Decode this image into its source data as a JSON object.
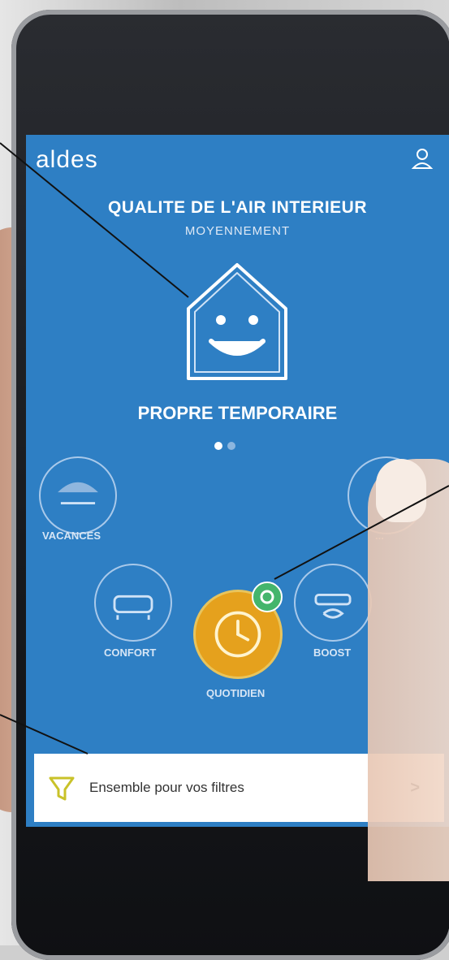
{
  "app": {
    "logo": "aldes",
    "user_icon": "user-icon"
  },
  "air_quality": {
    "title": "QUALITE DE L'AIR INTERIEUR",
    "subtitle": "MOYENNEMENT",
    "status": "PROPRE TEMPORAIRE",
    "page_index": 1,
    "page_count": 2
  },
  "modes": {
    "left_top_label": "VACANCES",
    "left_label": "CONFORT",
    "center_label": "QUOTIDIEN",
    "right_label": "BOOST",
    "right_top_label": "...",
    "active_color": "#e5a11d",
    "badge_color": "#44b56c"
  },
  "promo": {
    "text": "Ensemble pour vos filtres",
    "chevron": ">"
  },
  "colors": {
    "screen_bg": "#2e7fc4",
    "ring": "#a9c9ea"
  }
}
